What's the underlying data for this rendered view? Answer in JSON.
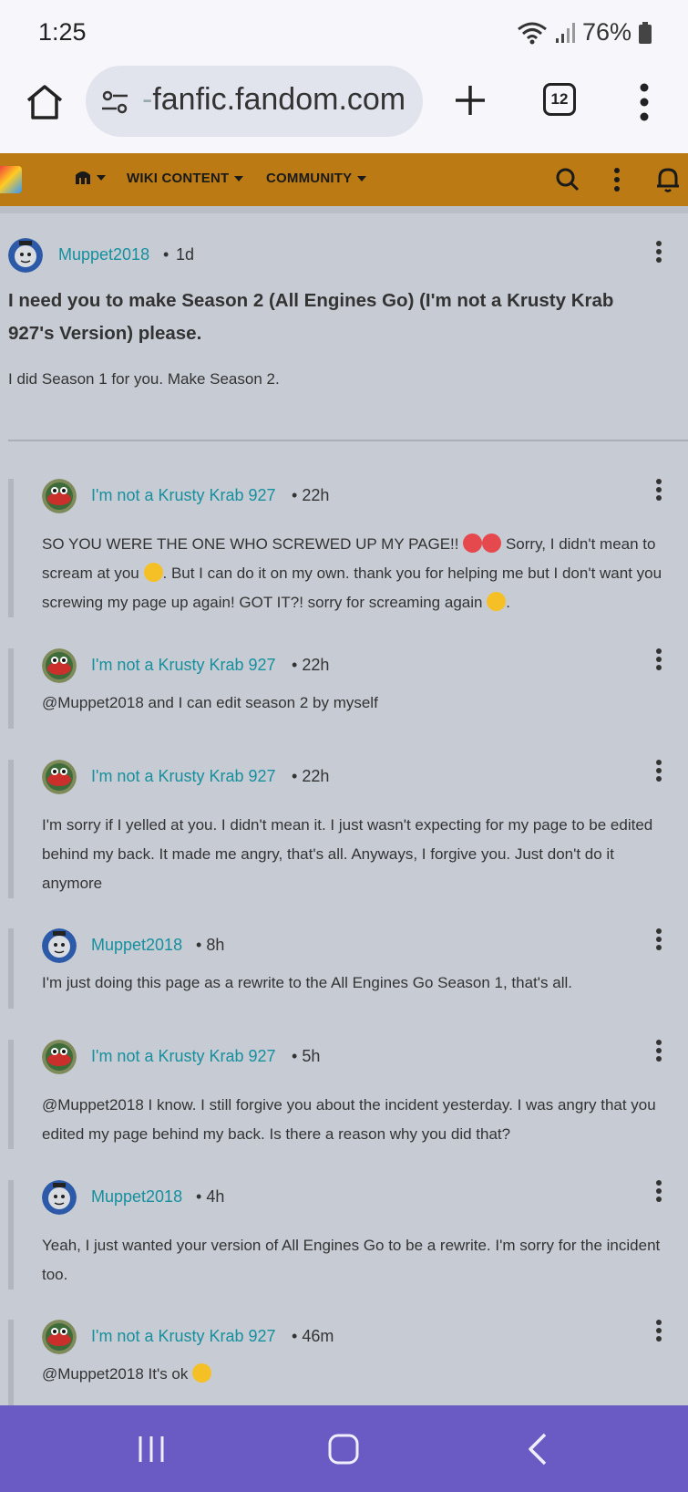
{
  "status": {
    "time": "1:25",
    "battery": "76%"
  },
  "browser": {
    "url_prefix": "-",
    "url": "fanfic.fandom.com",
    "tab_count": "12"
  },
  "wiki_nav": {
    "items": [
      "WIKI CONTENT",
      "COMMUNITY"
    ]
  },
  "post": {
    "author": "Muppet2018",
    "separator": "•",
    "time": "1d",
    "title": "I need you to make Season 2 (All Engines Go) (I'm not a Krusty Krab 927's Version) please.",
    "body": "I did Season 1 for you. Make Season 2."
  },
  "replies": [
    {
      "author": "I'm not a Krusty Krab 927",
      "time": "22h",
      "text_1": "SO YOU WERE THE ONE WHO SCREWED UP MY PAGE!! ",
      "text_2": " Sorry, I didn't mean to scream at you ",
      "text_3": ". But I can do it on my own. thank you for helping me but I don't want you screwing my page up again! GOT IT?! sorry for screaming again ",
      "text_4": "."
    },
    {
      "author": "I'm not a Krusty Krab 927",
      "time": "22h",
      "text": "@Muppet2018 and I can edit season 2 by myself"
    },
    {
      "author": "I'm not a Krusty Krab 927",
      "time": "22h",
      "text": "I'm sorry if I yelled at you. I didn't mean it. I just wasn't expecting for my page to be edited behind my back. It made me angry, that's all. Anyways, I forgive you. Just don't do it anymore"
    },
    {
      "author": "Muppet2018",
      "time": "8h",
      "text": "I'm just doing this page as a rewrite to the All Engines Go Season 1, that's all."
    },
    {
      "author": "I'm not a Krusty Krab 927",
      "time": "5h",
      "text": "@Muppet2018 I know. I still forgive you about the incident yesterday. I was angry that you edited my page behind my back. Is there a reason why you did that?"
    },
    {
      "author": "Muppet2018",
      "time": "4h",
      "text": "Yeah, I just wanted your version of All Engines Go to be a rewrite. I'm sorry for the incident too."
    },
    {
      "author": "I'm not a Krusty Krab 927",
      "time": "46m",
      "text": "@Muppet2018 It's ok "
    }
  ],
  "colors": {
    "username": "#168f9e",
    "nav_bg": "#bb7a14",
    "sysnav_bg": "#6a5bc4"
  }
}
